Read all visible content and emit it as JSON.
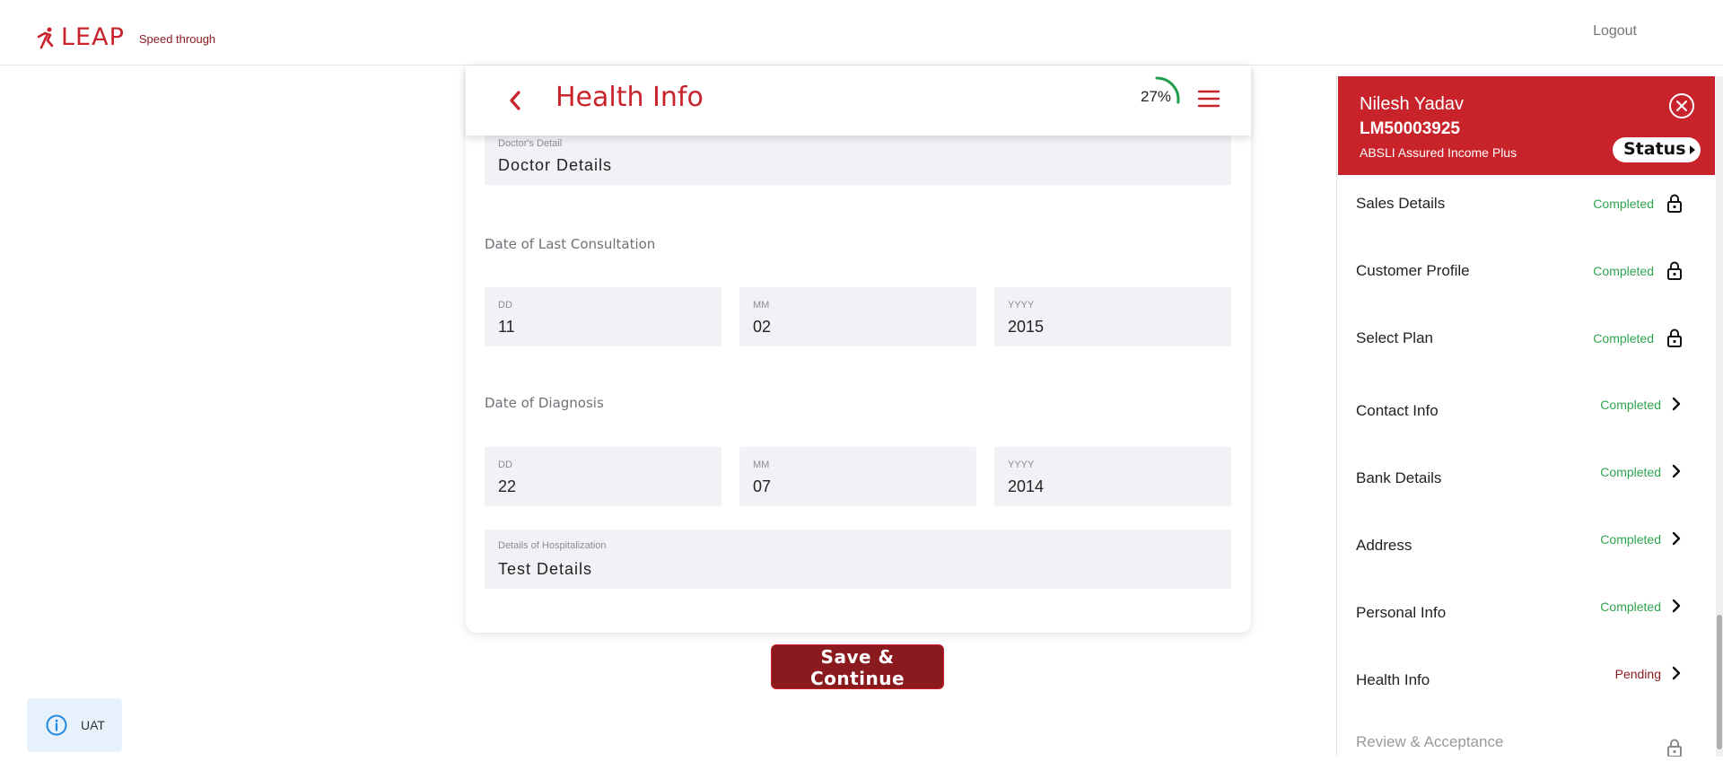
{
  "brand": {
    "name": "LEAP",
    "tagline": "Speed through",
    "color": "#c8222b"
  },
  "header": {
    "logout_label": "Logout"
  },
  "form": {
    "title": "Health Info",
    "progress_percent": 27,
    "progress_label": "27%",
    "doctor": {
      "label": "Doctor's Detail",
      "value": "Doctor Details"
    },
    "last_consultation": {
      "label": "Date of Last Consultation",
      "dd_label": "DD",
      "dd": "11",
      "mm_label": "MM",
      "mm": "02",
      "yyyy_label": "YYYY",
      "yyyy": "2015"
    },
    "diagnosis": {
      "label": "Date of Diagnosis",
      "dd_label": "DD",
      "dd": "22",
      "mm_label": "MM",
      "mm": "07",
      "yyyy_label": "YYYY",
      "yyyy": "2014"
    },
    "hospitalization": {
      "label": "Details of Hospitalization",
      "value": "Test Details"
    },
    "save_label": "Save & Continue"
  },
  "env_badge": {
    "label": "UAT",
    "icon": "info-icon"
  },
  "customer": {
    "name": "Nilesh Yadav",
    "id": "LM50003925",
    "plan": "ABSLI Assured Income Plus",
    "status_label": "Status"
  },
  "steps": [
    {
      "name": "Sales Details",
      "status": "Completed",
      "icon": "lock-icon"
    },
    {
      "name": "Customer Profile",
      "status": "Completed",
      "icon": "lock-icon"
    },
    {
      "name": "Select Plan",
      "status": "Completed",
      "icon": "lock-icon"
    },
    {
      "name": "Contact Info",
      "status": "Completed",
      "icon": "chevron-right-icon"
    },
    {
      "name": "Bank Details",
      "status": "Completed",
      "icon": "chevron-right-icon"
    },
    {
      "name": "Address",
      "status": "Completed",
      "icon": "chevron-right-icon"
    },
    {
      "name": "Personal Info",
      "status": "Completed",
      "icon": "chevron-right-icon"
    },
    {
      "name": "Health Info",
      "status": "Pending",
      "icon": "chevron-right-icon"
    },
    {
      "name": "Review & Acceptance",
      "status": "",
      "icon": "lock-icon"
    }
  ],
  "colors": {
    "completed": "#2ea44f",
    "pending": "#8b1a1f",
    "progress_arc": "#1e9e4a"
  }
}
